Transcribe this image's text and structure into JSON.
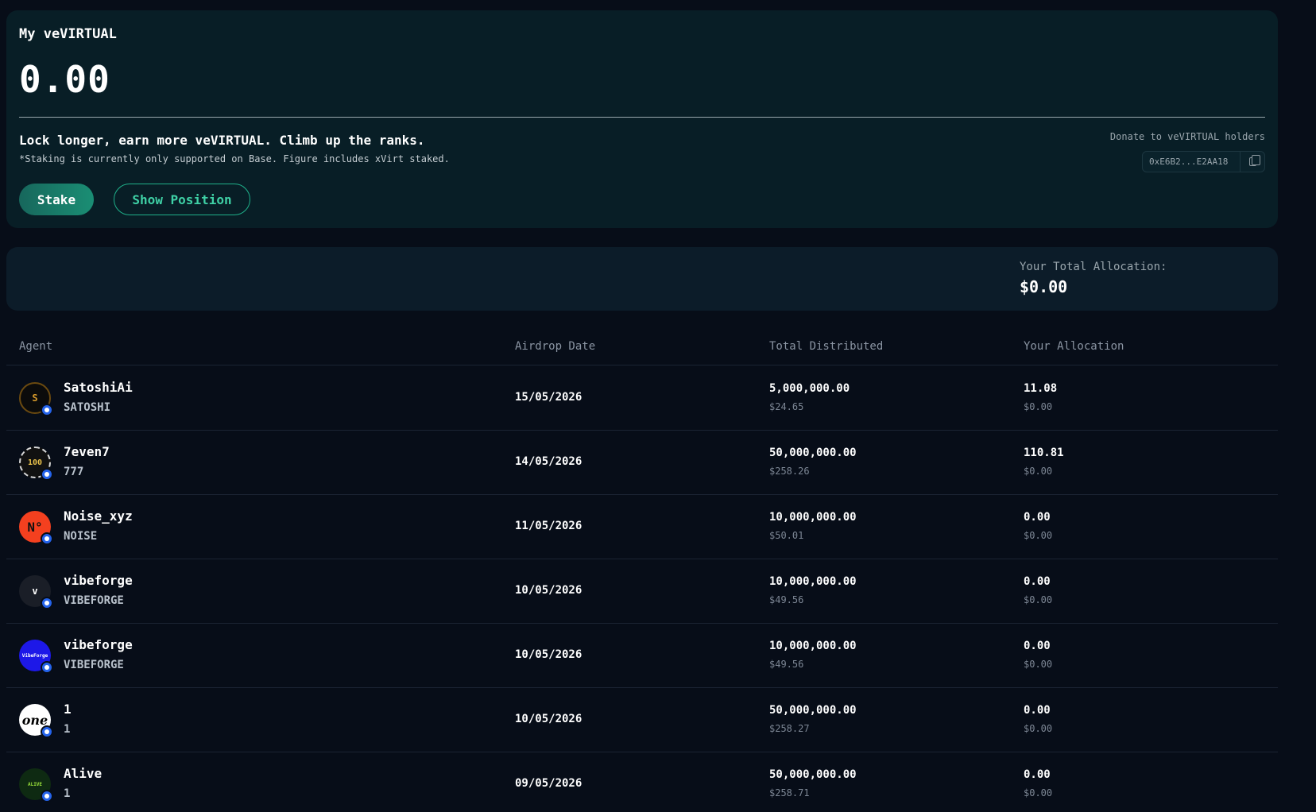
{
  "stake_card": {
    "title": "My veVIRTUAL",
    "value": "0.00",
    "tagline": "Lock longer, earn more veVIRTUAL. Climb up the ranks.",
    "footnote": "*Staking is currently only supported on Base. Figure includes xVirt staked.",
    "stake_label": "Stake",
    "show_position_label": "Show Position",
    "donate_label": "Donate to veVIRTUAL holders",
    "donate_address": "0xE6B2...E2AA18"
  },
  "allocation_card": {
    "label": "Your Total Allocation:",
    "value": "$0.00"
  },
  "table": {
    "headers": [
      "Agent",
      "Airdrop Date",
      "Total Distributed",
      "Your Allocation"
    ],
    "rows": [
      {
        "name": "SatoshiAi",
        "ticker": "SATOSHI",
        "date": "15/05/2026",
        "distributed": "5,000,000.00",
        "distributed_usd": "$24.65",
        "allocation": "11.08",
        "allocation_usd": "$0.00",
        "avatar_text": "S",
        "avatar_bg": "#0b0b0b",
        "avatar_fg": "#d79a2b"
      },
      {
        "name": "7even7",
        "ticker": "777",
        "date": "14/05/2026",
        "distributed": "50,000,000.00",
        "distributed_usd": "$258.26",
        "allocation": "110.81",
        "allocation_usd": "$0.00",
        "avatar_text": "100",
        "avatar_bg": "#111111",
        "avatar_fg": "#e8c04a"
      },
      {
        "name": "Noise_xyz",
        "ticker": "NOISE",
        "date": "11/05/2026",
        "distributed": "10,000,000.00",
        "distributed_usd": "$50.01",
        "allocation": "0.00",
        "allocation_usd": "$0.00",
        "avatar_text": "N°",
        "avatar_bg": "#f4401f",
        "avatar_fg": "#111111"
      },
      {
        "name": "vibeforge",
        "ticker": "VIBEFORGE",
        "date": "10/05/2026",
        "distributed": "10,000,000.00",
        "distributed_usd": "$49.56",
        "allocation": "0.00",
        "allocation_usd": "$0.00",
        "avatar_text": "v",
        "avatar_bg": "#1a1e27",
        "avatar_fg": "#ffffff"
      },
      {
        "name": "vibeforge",
        "ticker": "VIBEFORGE",
        "date": "10/05/2026",
        "distributed": "10,000,000.00",
        "distributed_usd": "$49.56",
        "allocation": "0.00",
        "allocation_usd": "$0.00",
        "avatar_text": "VibeForge",
        "avatar_bg": "#1d18e8",
        "avatar_fg": "#ffffff"
      },
      {
        "name": "1",
        "ticker": "1",
        "date": "10/05/2026",
        "distributed": "50,000,000.00",
        "distributed_usd": "$258.27",
        "allocation": "0.00",
        "allocation_usd": "$0.00",
        "avatar_text": "one",
        "avatar_bg": "#ffffff",
        "avatar_fg": "#000000"
      },
      {
        "name": "Alive",
        "ticker": "1",
        "date": "09/05/2026",
        "distributed": "50,000,000.00",
        "distributed_usd": "$258.71",
        "allocation": "0.00",
        "allocation_usd": "$0.00",
        "avatar_text": "ALIVE",
        "avatar_bg": "#0e2a12",
        "avatar_fg": "#9be33a"
      }
    ]
  },
  "colors": {
    "background": "#070d18",
    "stake_card": "#081e26",
    "allocation_card": "#0c1c29",
    "accent": "#1fb08a",
    "base_badge": "#2463eb"
  }
}
